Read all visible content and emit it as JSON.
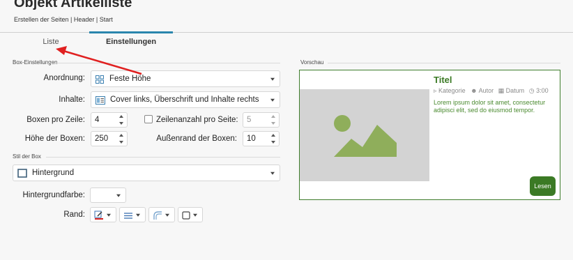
{
  "header": {
    "title": "Objekt Artikelliste",
    "breadcrumb": "Erstellen der Seiten | Header | Start"
  },
  "tabs": [
    {
      "label": "Liste",
      "active": false
    },
    {
      "label": "Einstellungen",
      "active": true
    }
  ],
  "box_settings": {
    "section_label": "Box-Einstellungen",
    "anordnung": {
      "label": "Anordnung:",
      "value": "Feste Höhe",
      "icon": "grid-layout-icon"
    },
    "inhalte": {
      "label": "Inhalte:",
      "value": "Cover links, Überschrift und Inhalte rechts",
      "icon": "cover-left-layout-icon"
    },
    "boxen_pro_zeile": {
      "label": "Boxen pro Zeile:",
      "value": "4"
    },
    "zeilenanzahl": {
      "label": "Zeilenanzahl pro Seite:",
      "value": "5",
      "checked": false
    },
    "hoehe": {
      "label": "Höhe der Boxen:",
      "value": "250"
    },
    "aussenrand": {
      "label": "Außenrand der Boxen:",
      "value": "10"
    }
  },
  "box_style": {
    "section_label": "Stil der Box",
    "stil": {
      "value": "Hintergrund",
      "icon": "box-background-icon"
    },
    "hintergrundfarbe": {
      "label": "Hintergrundfarbe:",
      "value": ""
    },
    "rand": {
      "label": "Rand:"
    }
  },
  "preview": {
    "section_label": "Vorschau",
    "title": "Titel",
    "meta": {
      "kategorie": "Kategorie",
      "autor": "Autor",
      "datum": "Datum",
      "zeit": "3:00"
    },
    "text": "Lorem ipsum dolor sit amet, consectetur adipisci elit, sed do eiusmod tempor.",
    "button": "Lesen",
    "colors": {
      "accent": "#3b7a25",
      "image_bg": "#d3d3d3",
      "image_fg": "#8fae5b"
    }
  },
  "colors": {
    "tab_active": "#2a86ad",
    "annotation_arrow": "#e02020"
  }
}
